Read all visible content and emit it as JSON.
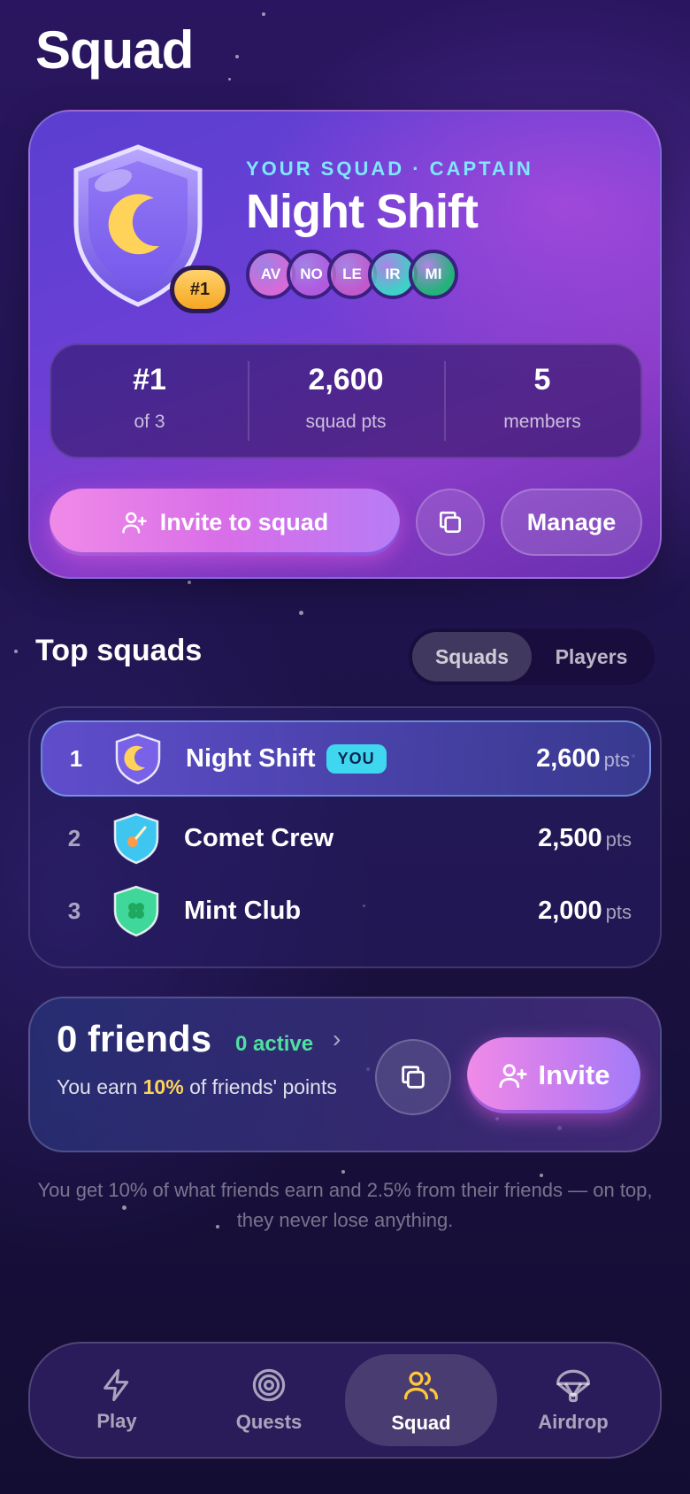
{
  "page": {
    "title": "Squad"
  },
  "squad": {
    "eyebrow": "YOUR SQUAD · CAPTAIN",
    "name": "Night Shift",
    "rank_badge": "#1",
    "members": [
      {
        "initials": "AV",
        "color": "#d56ad8"
      },
      {
        "initials": "NO",
        "color": "#b05ae0"
      },
      {
        "initials": "LE",
        "color": "#c05acc"
      },
      {
        "initials": "IR",
        "color": "#3fd0c8"
      },
      {
        "initials": "MI",
        "color": "#24b27a"
      }
    ],
    "stats": [
      {
        "value": "#1",
        "label": "of 3"
      },
      {
        "value": "2,600",
        "label": "squad pts"
      },
      {
        "value": "5",
        "label": "members"
      }
    ],
    "invite_label": "Invite to squad",
    "manage_label": "Manage"
  },
  "top_squads": {
    "title": "Top squads",
    "tabs": [
      {
        "label": "Squads",
        "active": true
      },
      {
        "label": "Players",
        "active": false
      }
    ],
    "unit": "pts",
    "rows": [
      {
        "rank": "1",
        "name": "Night Shift",
        "badge": "YOU",
        "points": "2,600",
        "icon": "moon-icon",
        "shield_color": "#7a62e8"
      },
      {
        "rank": "2",
        "name": "Comet Crew",
        "badge": "",
        "points": "2,500",
        "icon": "comet-icon",
        "shield_color": "#3fc6f0"
      },
      {
        "rank": "3",
        "name": "Mint Club",
        "badge": "",
        "points": "2,000",
        "icon": "clover-icon",
        "shield_color": "#3fd89a"
      }
    ]
  },
  "friends": {
    "count": "0 friends",
    "active": "0 active",
    "desc_prefix": "You earn ",
    "desc_highlight": "10%",
    "desc_suffix": " of friends' points",
    "invite_label": "Invite"
  },
  "footnote": "You get 10% of what friends earn and 2.5% from their friends — on top, they never lose anything.",
  "nav": [
    {
      "label": "Play",
      "icon": "lightning-icon",
      "active": false
    },
    {
      "label": "Quests",
      "icon": "target-icon",
      "active": false
    },
    {
      "label": "Squad",
      "icon": "users-icon",
      "active": true
    },
    {
      "label": "Airdrop",
      "icon": "parachute-icon",
      "active": false
    }
  ],
  "colors": {
    "accent_cyan": "#7fe7ff",
    "accent_gold": "#ffd35a",
    "accent_green": "#4fe0a0",
    "active_nav": "#ffc83a"
  }
}
